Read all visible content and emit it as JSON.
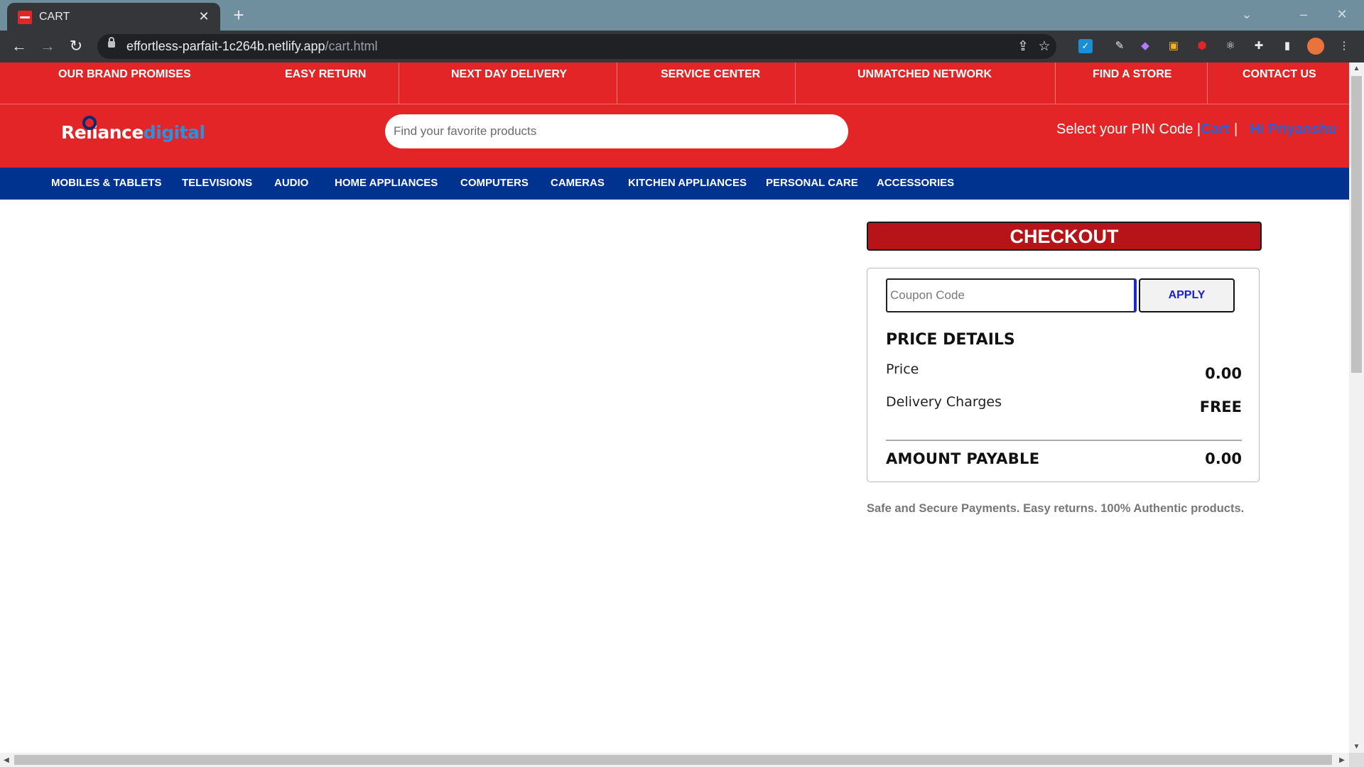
{
  "browser": {
    "tab_title": "CART",
    "url_host": "effortless-parfait-1c264b.netlify.app",
    "url_path": "/cart.html"
  },
  "promises": [
    "OUR BRAND PROMISES",
    "EASY RETURN",
    "NEXT DAY DELIVERY",
    "SERVICE CENTER",
    "UNMATCHED NETWORK",
    "FIND A STORE",
    "CONTACT US"
  ],
  "header": {
    "logo_part1": "Reliance",
    "logo_part2": "digital",
    "search_placeholder": "Find your favorite products",
    "pin_label": "Select your PIN Code |",
    "cart_label": "Cart",
    "separator": "|",
    "user_label": "Hi Priyanshu"
  },
  "categories": [
    "MOBILES & TABLETS",
    "TELEVISIONS",
    "AUDIO",
    "HOME APPLIANCES",
    "COMPUTERS",
    "CAMERAS",
    "KITCHEN APPLIANCES",
    "PERSONAL CARE",
    "ACCESSORIES"
  ],
  "checkout": {
    "button_label": "CHECKOUT",
    "coupon_placeholder": "Coupon Code",
    "apply_label": "APPLY",
    "price_details_title": "PRICE DETAILS",
    "price_label": "Price",
    "price_value": "0.00",
    "delivery_label": "Delivery Charges",
    "delivery_value": "FREE",
    "amount_label": "AMOUNT PAYABLE",
    "amount_value": "0.00",
    "secure_text": "Safe and Secure Payments. Easy returns. 100% Authentic products."
  },
  "colors": {
    "brand_red": "#e42527",
    "nav_blue": "#003390",
    "checkout_red": "#b61419",
    "link_blue": "#2d5fd3"
  }
}
